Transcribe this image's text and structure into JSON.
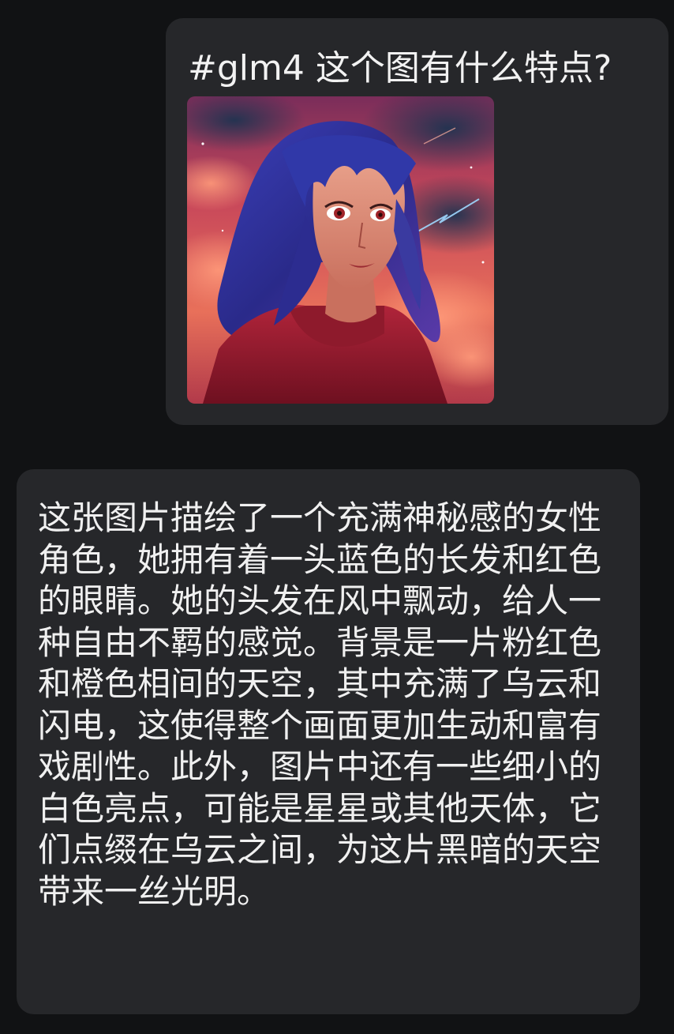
{
  "messages": {
    "user": {
      "text": "#glm4 这个图有什么特点?"
    },
    "assistant": {
      "text": "这张图片描绘了一个充满神秘感的女性角色，她拥有着一头蓝色的长发和红色的眼睛。她的头发在风中飘动，给人一种自由不羁的感觉。背景是一片粉红色和橙色相间的天空，其中充满了乌云和闪电，这使得整个画面更加生动和富有戏剧性。此外，图片中还有一些细小的白色亮点，可能是星星或其他天体，它们点缀在乌云之间，为这片黑暗的天空带来一丝光明。"
    }
  },
  "colors": {
    "background": "#111214",
    "bubble": "#26272a",
    "text": "#f0f0f0"
  }
}
